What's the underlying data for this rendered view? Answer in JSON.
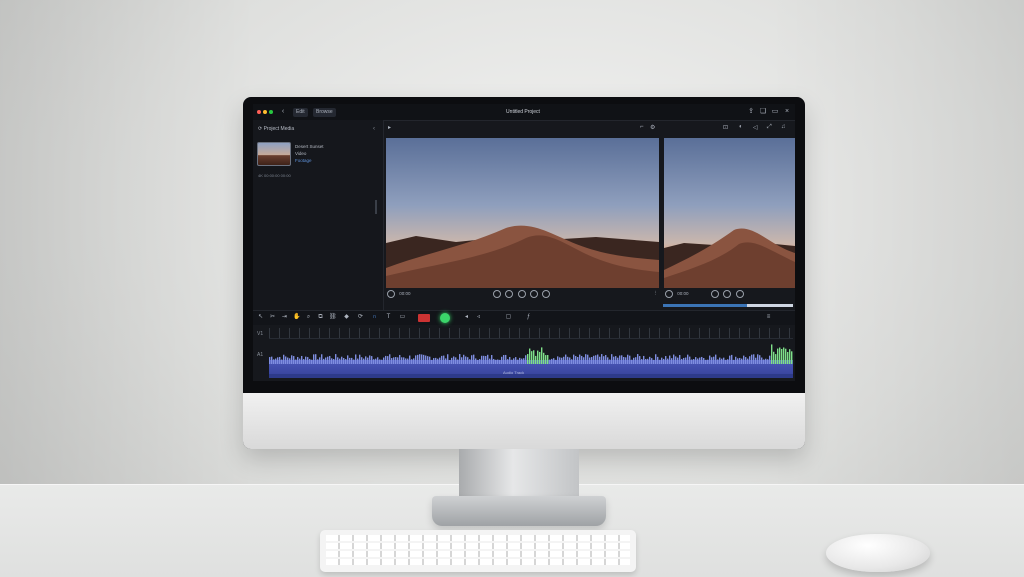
{
  "app": {
    "window_title": "Untitled Project",
    "top_tabs": [
      "Edit",
      "Browse"
    ],
    "top_icons": [
      "share-icon",
      "bookmark-icon",
      "window-icon",
      "close-icon"
    ]
  },
  "left_panel": {
    "header": "Project Media",
    "clip": {
      "name": "Desert Sunset",
      "line2": "Video",
      "line3": "Footage"
    },
    "clip_meta": "4K 00:00:00 00:00"
  },
  "viewer": {
    "main_time": "00:00",
    "side_time": "00:00"
  },
  "timeline": {
    "track_labels": [
      "V1",
      "A1"
    ],
    "wave_caption": "Audio Track"
  },
  "colors": {
    "accent_green": "#3bd56a",
    "record_red": "#cc3333",
    "waveform_blue": "#4a56b8",
    "progress_blue": "#3b74b6"
  }
}
